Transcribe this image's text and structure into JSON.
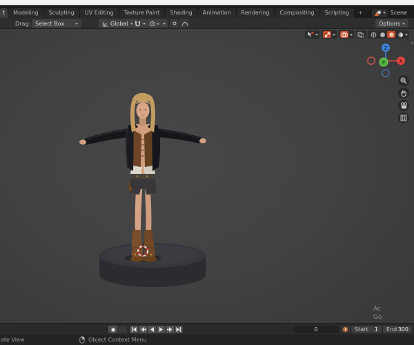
{
  "topbar": {
    "tabs": [
      {
        "label": "t",
        "active": true
      },
      {
        "label": "Modeling"
      },
      {
        "label": "Sculpting"
      },
      {
        "label": "UV Editing"
      },
      {
        "label": "Texture Paint"
      },
      {
        "label": "Shading"
      },
      {
        "label": "Animation"
      },
      {
        "label": "Rendering"
      },
      {
        "label": "Compositing"
      },
      {
        "label": "Scripting"
      },
      {
        "label": "+"
      }
    ],
    "scene": {
      "label": "Scene"
    }
  },
  "tool_settings": {
    "drag_label": "Drag:",
    "select_mode": "Select Box",
    "orientation": "Global",
    "options_label": "Options"
  },
  "viewport": {
    "gizmo_axes": {
      "x": "X",
      "y": "Y",
      "z": "Z"
    },
    "fragments": {
      "line1": "Ac",
      "line2": "Go"
    },
    "sidebar_toggle": "‹"
  },
  "timeline": {
    "current_frame": "0",
    "start_label": "Start",
    "start_value": "1",
    "end_label": "End",
    "end_value": "300"
  },
  "statusbar": {
    "left_text": "ate View",
    "context_menu": "Object Context Menu"
  },
  "colors": {
    "accent_active": "#bf4b2c",
    "axis_x": "#e0453c",
    "axis_y": "#4fae3a",
    "axis_z": "#3f83d6",
    "viewport_bg": "#424242",
    "top_strip": "#f2f2f2"
  },
  "icons": {
    "scene-icon": "cone+sphere glyph",
    "chevron-down-icon": "css triangle",
    "magnet-icon": "snap",
    "proportional-icon": "falloff",
    "visibility-icon": "object type visibility",
    "gizmo-icon": "show gizmos (on)",
    "overlays-icon": "show overlays (on)",
    "xray-icon": "toggle x-ray",
    "wireframe-icon": "shading wireframe",
    "solid-icon": "shading solid",
    "material-icon": "shading material preview (active)",
    "rendered-icon": "shading rendered",
    "zoom-icon": "magnifier",
    "pan-icon": "hand",
    "camera-icon": "camera view",
    "ortho-icon": "toggle perspective/orthographic",
    "clock-icon": "use preview range",
    "record-icon": "auto keying",
    "mouse-icon": "right-click hint"
  }
}
